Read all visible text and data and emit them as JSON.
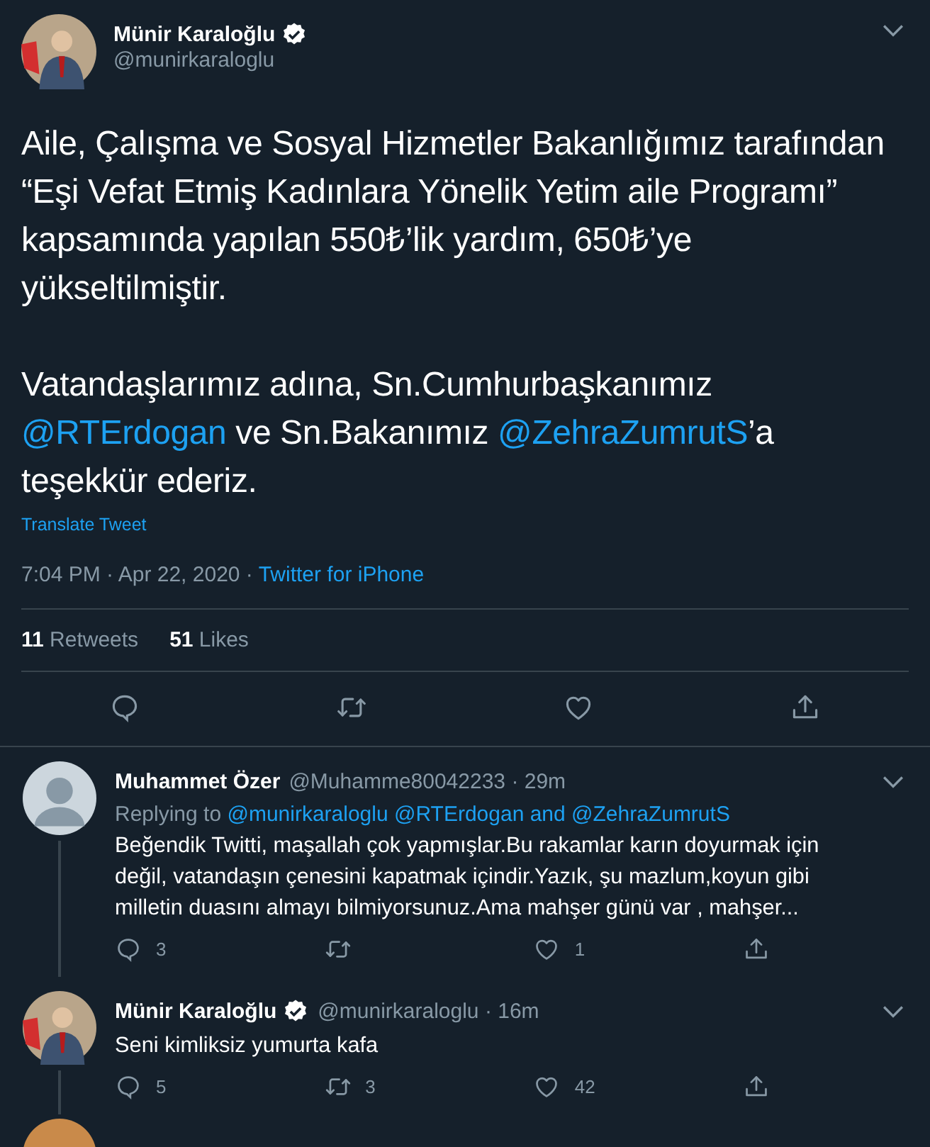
{
  "main_tweet": {
    "author": {
      "name": "Münir Karaloğlu",
      "verified": true,
      "handle": "@munirkaraloglu"
    },
    "paragraphs": [
      [
        {
          "kind": "text",
          "text": "Aile, Çalışma ve Sosyal Hizmetler Bakanlığımız tarafından “Eşi Vefat Etmiş Kadınlara Yönelik Yetim aile Programı” kapsamında yapılan 550₺’lik yardım, 650₺’ye yükseltilmiştir."
        }
      ],
      [
        {
          "kind": "text",
          "text": "Vatandaşlarımız adına, Sn.Cumhurbaşkanımız "
        },
        {
          "kind": "mention",
          "text": "@RTErdogan"
        },
        {
          "kind": "text",
          "text": " ve Sn.Bakanımız "
        },
        {
          "kind": "mention",
          "text": "@ZehraZumrutS"
        },
        {
          "kind": "text",
          "text": "’a teşekkür ederiz."
        }
      ]
    ],
    "translate_link": "Translate Tweet",
    "time": "7:04 PM · Apr 22, 2020 ·",
    "source": "Twitter for iPhone",
    "stats": [
      {
        "count": "11",
        "label": "Retweets"
      },
      {
        "count": "51",
        "label": "Likes"
      }
    ],
    "actions": [
      {
        "kind": "reply"
      },
      {
        "kind": "retweet"
      },
      {
        "kind": "like"
      },
      {
        "kind": "share"
      }
    ]
  },
  "replies": [
    {
      "author": {
        "name": "Muhammet Özer",
        "verified": false,
        "meta": "@Muhamme80042233 · 29m"
      },
      "replying_prefix": "Replying to",
      "replying_mentions": [
        "@munirkaraloglu",
        "@RTErdogan and @ZehraZumrutS"
      ],
      "text": "Beğendik Twitti, maşallah çok yapmışlar.Bu rakamlar karın doyurmak için değil, vatandaşın çenesini kapatmak içindir.Yazık, şu mazlum,koyun gibi milletin duasını almayı bilmiyorsunuz.Ama mahşer günü var , mahşer...",
      "actions": [
        {
          "kind": "reply",
          "count": "3"
        },
        {
          "kind": "retweet"
        },
        {
          "kind": "like",
          "count": "1"
        },
        {
          "kind": "share"
        }
      ]
    },
    {
      "author": {
        "name": "Münir Karaloğlu",
        "verified": true,
        "meta": "@munirkaraloglu · 16m"
      },
      "text": "Seni kimliksiz yumurta kafa",
      "actions": [
        {
          "kind": "reply",
          "count": "5"
        },
        {
          "kind": "retweet",
          "count": "3"
        },
        {
          "kind": "like",
          "count": "42"
        },
        {
          "kind": "share"
        }
      ]
    }
  ]
}
